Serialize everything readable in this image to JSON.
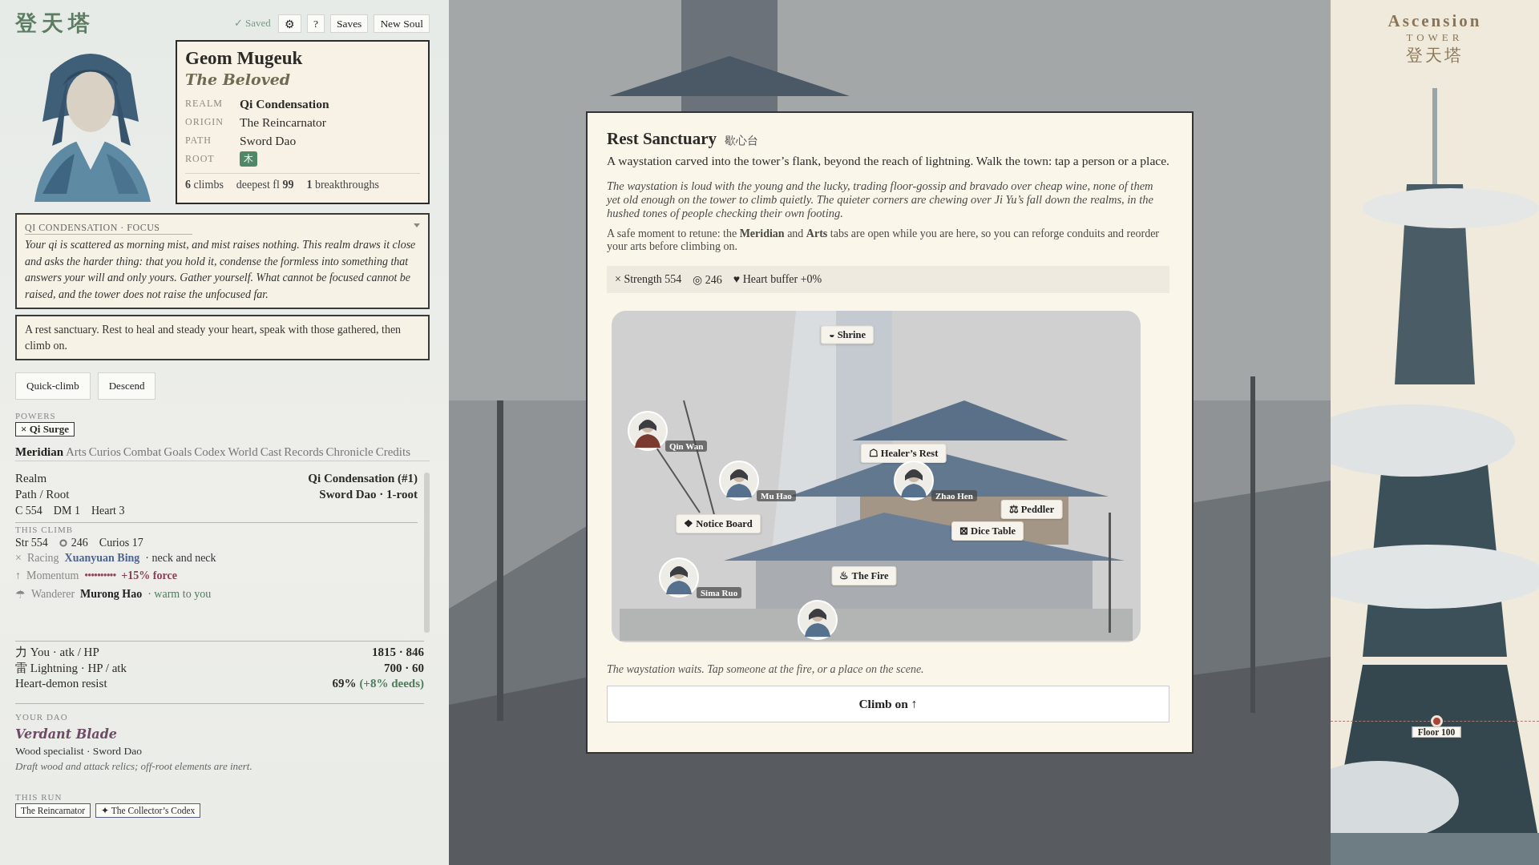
{
  "app": {
    "logo": "登天塔",
    "saved": "✓ Saved",
    "toolbar": [
      "⚙",
      "?",
      "Saves",
      "New Soul"
    ]
  },
  "character": {
    "name": "Geom Mugeuk",
    "epithet": "The Beloved",
    "fields": [
      {
        "label": "REALM",
        "value": "Qi Condensation",
        "kind": "realm"
      },
      {
        "label": "ORIGIN",
        "value": "The Reincarnator",
        "kind": "text"
      },
      {
        "label": "PATH",
        "value": "Sword Dao",
        "kind": "text"
      },
      {
        "label": "ROOT",
        "value": "木",
        "kind": "badge"
      }
    ],
    "stats": [
      "**6** climbs",
      "deepest fl **99**",
      "**1** breakthroughs"
    ]
  },
  "focus": {
    "title": "QI CONDENSATION · FOCUS",
    "expanded": true,
    "text": "Your qi is scattered as morning mist, and mist raises nothing. This realm draws it close and asks the harder thing: that you hold it, condense the formless into something that answers your will and only yours. Gather yourself. What cannot be focused cannot be raised, and the tower does not raise the unfocused far."
  },
  "note": "A rest sanctuary. Rest to heal and steady your heart, speak with those gathered, then climb on.",
  "actions": [
    "Quick-climb",
    "Descend"
  ],
  "powers": {
    "label": "POWERS",
    "items": [
      "× Qi Surge"
    ]
  },
  "tabs": [
    {
      "label": "Meridian",
      "selected": true
    },
    {
      "label": "Arts",
      "selected": false
    },
    {
      "label": "Curios",
      "selected": false
    },
    {
      "label": "Combat",
      "selected": false
    },
    {
      "label": "Goals",
      "selected": false
    },
    {
      "label": "Codex",
      "selected": false
    },
    {
      "label": "World",
      "selected": false
    },
    {
      "label": "Cast",
      "selected": false
    },
    {
      "label": "Records",
      "selected": false
    },
    {
      "label": "Chronicle",
      "selected": false
    },
    {
      "label": "Credits",
      "selected": false
    }
  ],
  "summary": {
    "rows": [
      {
        "label": "Realm",
        "value": "Qi Condensation (#1)"
      },
      {
        "label": "Path / Root",
        "value": "Sword Dao · 1-root"
      }
    ],
    "stats": [
      "C 554",
      "DM 1",
      "Heart 3"
    ]
  },
  "this_climb": {
    "label": "THIS CLIMB",
    "stats": [
      {
        "kind": "text",
        "value": "Str 554"
      },
      {
        "kind": "ring",
        "value": "246"
      },
      {
        "kind": "text",
        "value": "Curios 17"
      }
    ],
    "lines": [
      {
        "kind": "rival",
        "icon": "×",
        "label": "Racing",
        "name": "Xuanyuan Bing",
        "note": "· neck and neck"
      },
      {
        "kind": "momentum",
        "icon": "↑",
        "label": "Momentum",
        "meter": "••••••••••",
        "note": "+15% force"
      },
      {
        "kind": "companion",
        "icon": "☂",
        "label": "Wanderer",
        "name": "Murong Hao",
        "note": "· warm to you"
      }
    ]
  },
  "combat": [
    {
      "label": "力 You · atk / HP",
      "value": "1815 · 846"
    },
    {
      "label": "雷 Lightning · HP / atk",
      "value": "700 · 60"
    },
    {
      "label": "Heart-demon resist",
      "value": "69%",
      "note": "(+8% deeds)"
    }
  ],
  "dao": {
    "label": "YOUR DAO",
    "name": "Verdant Blade",
    "type": "Wood specialist · Sword Dao",
    "hint": "Draft wood and attack relics; off-root elements are inert."
  },
  "run": {
    "label": "THIS RUN",
    "tags": [
      "The Reincarnator",
      "✦ The Collector’s Codex"
    ]
  },
  "modal": {
    "title": "Rest Sanctuary",
    "subtitle": "歇心台",
    "intro": "A waystation carved into the tower’s flank, beyond the reach of lightning. Walk the town: tap a person or a place.",
    "story": "The waystation is loud with the young and the lucky, trading floor-gossip and bravado over cheap wine, none of them yet old enough on the tower to climb quietly. The quieter corners are chewing over Ji Yu’s fall down the realms, in the hushed tones of people checking their own footing.",
    "retune": "A safe moment to retune: the **Meridian** and **Arts** tabs are open while you are here, so you can reforge conduits and reorder your arts before climbing on.",
    "stats": [
      "× Strength 554",
      "◎ 246",
      "♥ Heart buffer +0%"
    ],
    "places": [
      {
        "icon": "◒",
        "label": "Shrine"
      },
      {
        "icon": "☖",
        "label": "Healer’s Rest"
      },
      {
        "icon": "❖",
        "label": "Notice Board"
      },
      {
        "icon": "⚖",
        "label": "Peddler"
      },
      {
        "icon": "⊠",
        "label": "Dice Table"
      },
      {
        "icon": "♨",
        "label": "The Fire"
      }
    ],
    "people": [
      {
        "kind": "named",
        "name": "Qin Wan"
      },
      {
        "kind": "named",
        "name": "Mu Hao"
      },
      {
        "kind": "named",
        "name": "Zhao Hen"
      },
      {
        "kind": "named",
        "name": "Sima Ruo"
      },
      {
        "kind": "unnamed"
      }
    ],
    "caption": "The waystation waits. Tap someone at the fire, or a place on the scene.",
    "button": "Climb on ↑"
  },
  "tower": {
    "title": "Ascension",
    "subtitle": "TOWER",
    "glyphs": "登天塔",
    "marker": "Floor 100"
  }
}
